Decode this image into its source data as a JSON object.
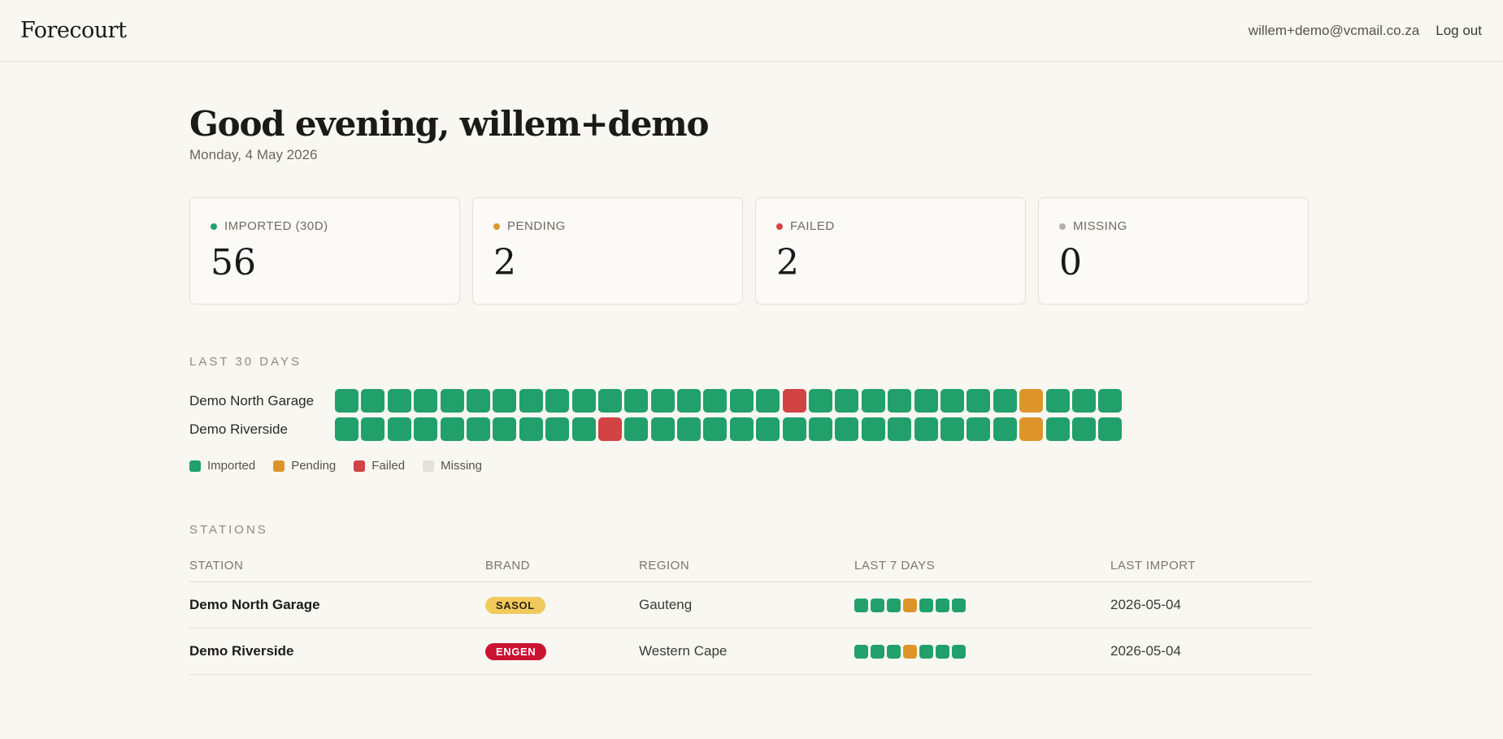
{
  "app": {
    "title": "Forecourt"
  },
  "header": {
    "user_email": "willem+demo@vcmail.co.za",
    "logout_label": "Log out"
  },
  "greeting": {
    "title": "Good evening, willem+demo",
    "date": "Monday, 4 May 2026"
  },
  "colors": {
    "imported": "#22a06b",
    "pending": "#dd952b",
    "failed": "#d24343",
    "missing": "#e2e0db",
    "sasol": "#f2c95c",
    "engen": "#cc1231"
  },
  "stats": [
    {
      "label": "IMPORTED (30D)",
      "value": "56",
      "status": "imported",
      "dot_color": "#22a06b"
    },
    {
      "label": "PENDING",
      "value": "2",
      "status": "pending",
      "dot_color": "#dd952b"
    },
    {
      "label": "FAILED",
      "value": "2",
      "status": "failed",
      "dot_color": "#d24343"
    },
    {
      "label": "MISSING",
      "value": "0",
      "status": "missing",
      "dot_color": "#b3b0aa"
    }
  ],
  "last30": {
    "section_label": "LAST 30 DAYS",
    "rows": [
      {
        "name": "Demo North Garage",
        "days": [
          "imported",
          "imported",
          "imported",
          "imported",
          "imported",
          "imported",
          "imported",
          "imported",
          "imported",
          "imported",
          "imported",
          "imported",
          "imported",
          "imported",
          "imported",
          "imported",
          "imported",
          "failed",
          "imported",
          "imported",
          "imported",
          "imported",
          "imported",
          "imported",
          "imported",
          "imported",
          "pending",
          "imported",
          "imported",
          "imported"
        ]
      },
      {
        "name": "Demo Riverside",
        "days": [
          "imported",
          "imported",
          "imported",
          "imported",
          "imported",
          "imported",
          "imported",
          "imported",
          "imported",
          "imported",
          "failed",
          "imported",
          "imported",
          "imported",
          "imported",
          "imported",
          "imported",
          "imported",
          "imported",
          "imported",
          "imported",
          "imported",
          "imported",
          "imported",
          "imported",
          "imported",
          "pending",
          "imported",
          "imported",
          "imported"
        ]
      }
    ],
    "legend": [
      {
        "label": "Imported",
        "status": "imported"
      },
      {
        "label": "Pending",
        "status": "pending"
      },
      {
        "label": "Failed",
        "status": "failed"
      },
      {
        "label": "Missing",
        "status": "missing"
      }
    ]
  },
  "stations": {
    "section_label": "STATIONS",
    "columns": [
      "STATION",
      "BRAND",
      "REGION",
      "LAST 7 DAYS",
      "LAST IMPORT"
    ],
    "rows": [
      {
        "station": "Demo North Garage",
        "brand": "SASOL",
        "brand_bg": "#f2c95c",
        "brand_fg": "#2b2414",
        "region": "Gauteng",
        "last7": [
          "imported",
          "imported",
          "imported",
          "pending",
          "imported",
          "imported",
          "imported"
        ],
        "last_import": "2026-05-04"
      },
      {
        "station": "Demo Riverside",
        "brand": "ENGEN",
        "brand_bg": "#cc1231",
        "brand_fg": "#ffffff",
        "region": "Western Cape",
        "last7": [
          "imported",
          "imported",
          "imported",
          "pending",
          "imported",
          "imported",
          "imported"
        ],
        "last_import": "2026-05-04"
      }
    ]
  }
}
